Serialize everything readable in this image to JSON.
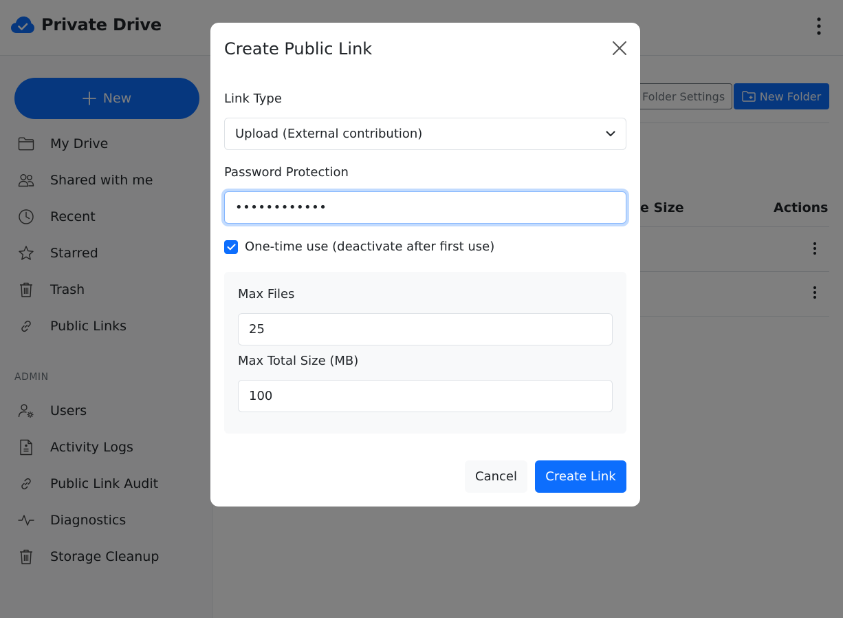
{
  "header": {
    "title": "Private Drive"
  },
  "sidebar": {
    "new_label": "New",
    "items": [
      {
        "label": "My Drive",
        "icon": "folder-icon"
      },
      {
        "label": "Shared with me",
        "icon": "people-icon"
      },
      {
        "label": "Recent",
        "icon": "clock-icon"
      },
      {
        "label": "Starred",
        "icon": "star-icon"
      },
      {
        "label": "Trash",
        "icon": "trash-icon"
      },
      {
        "label": "Public Links",
        "icon": "link-icon"
      }
    ],
    "admin_label": "ADMIN",
    "admin_items": [
      {
        "label": "Users",
        "icon": "user-gear-icon"
      },
      {
        "label": "Activity Logs",
        "icon": "document-icon"
      },
      {
        "label": "Public Link Audit",
        "icon": "link-icon"
      },
      {
        "label": "Diagnostics",
        "icon": "activity-icon"
      },
      {
        "label": "Storage Cleanup",
        "icon": "trash-icon"
      }
    ]
  },
  "toolbar": {
    "folder_settings_label": "Folder Settings",
    "new_folder_label": "New Folder"
  },
  "table": {
    "col_size_partial": "e Size",
    "col_actions": "Actions"
  },
  "modal": {
    "title": "Create Public Link",
    "link_type_label": "Link Type",
    "link_type_value": "Upload (External contribution)",
    "password_label": "Password Protection",
    "password_value": "••••••••••••",
    "one_time_label": "One-time use (deactivate after first use)",
    "one_time_checked": true,
    "max_files_label": "Max Files",
    "max_files_value": "25",
    "max_size_label": "Max Total Size (MB)",
    "max_size_value": "100",
    "cancel_label": "Cancel",
    "create_label": "Create Link"
  },
  "colors": {
    "primary": "#0d6efd",
    "overlay": "rgba(0,0,0,0.5)"
  }
}
